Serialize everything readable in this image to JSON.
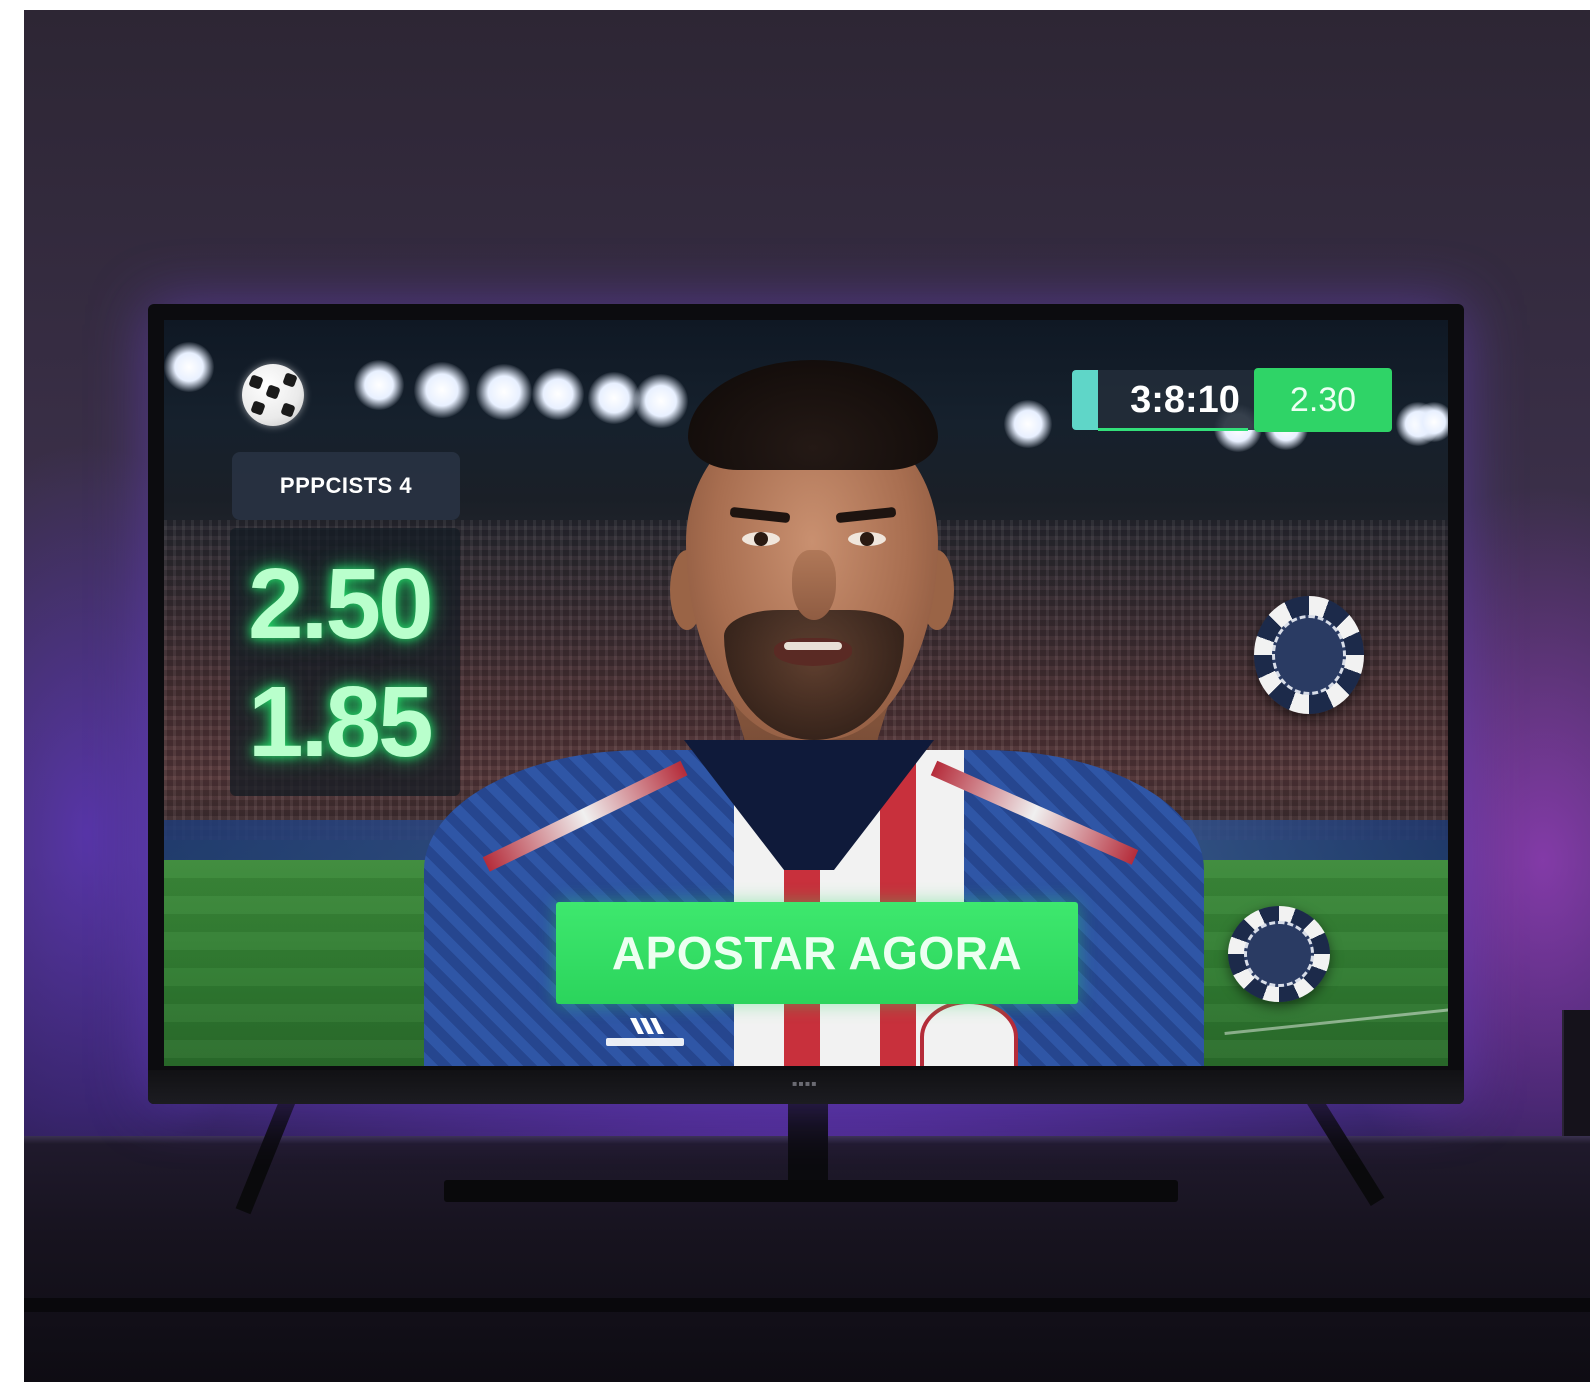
{
  "overlay": {
    "tag_label": "PPPCISTS 4",
    "odds": [
      "2.50",
      "1.85"
    ],
    "timer": "3:8:10",
    "rate": "2.30",
    "cta_label": "APOSTAR AGORA"
  },
  "icons": {
    "ball": "soccer-ball-icon",
    "chip_top": "poker-chip-icon",
    "chip_bottom": "poker-chip-icon"
  },
  "colors": {
    "accent_green": "#2fd467",
    "odds_glow": "#22e06a",
    "ambient_purple": "#6b3ad8",
    "panel_dark": "#283242"
  }
}
